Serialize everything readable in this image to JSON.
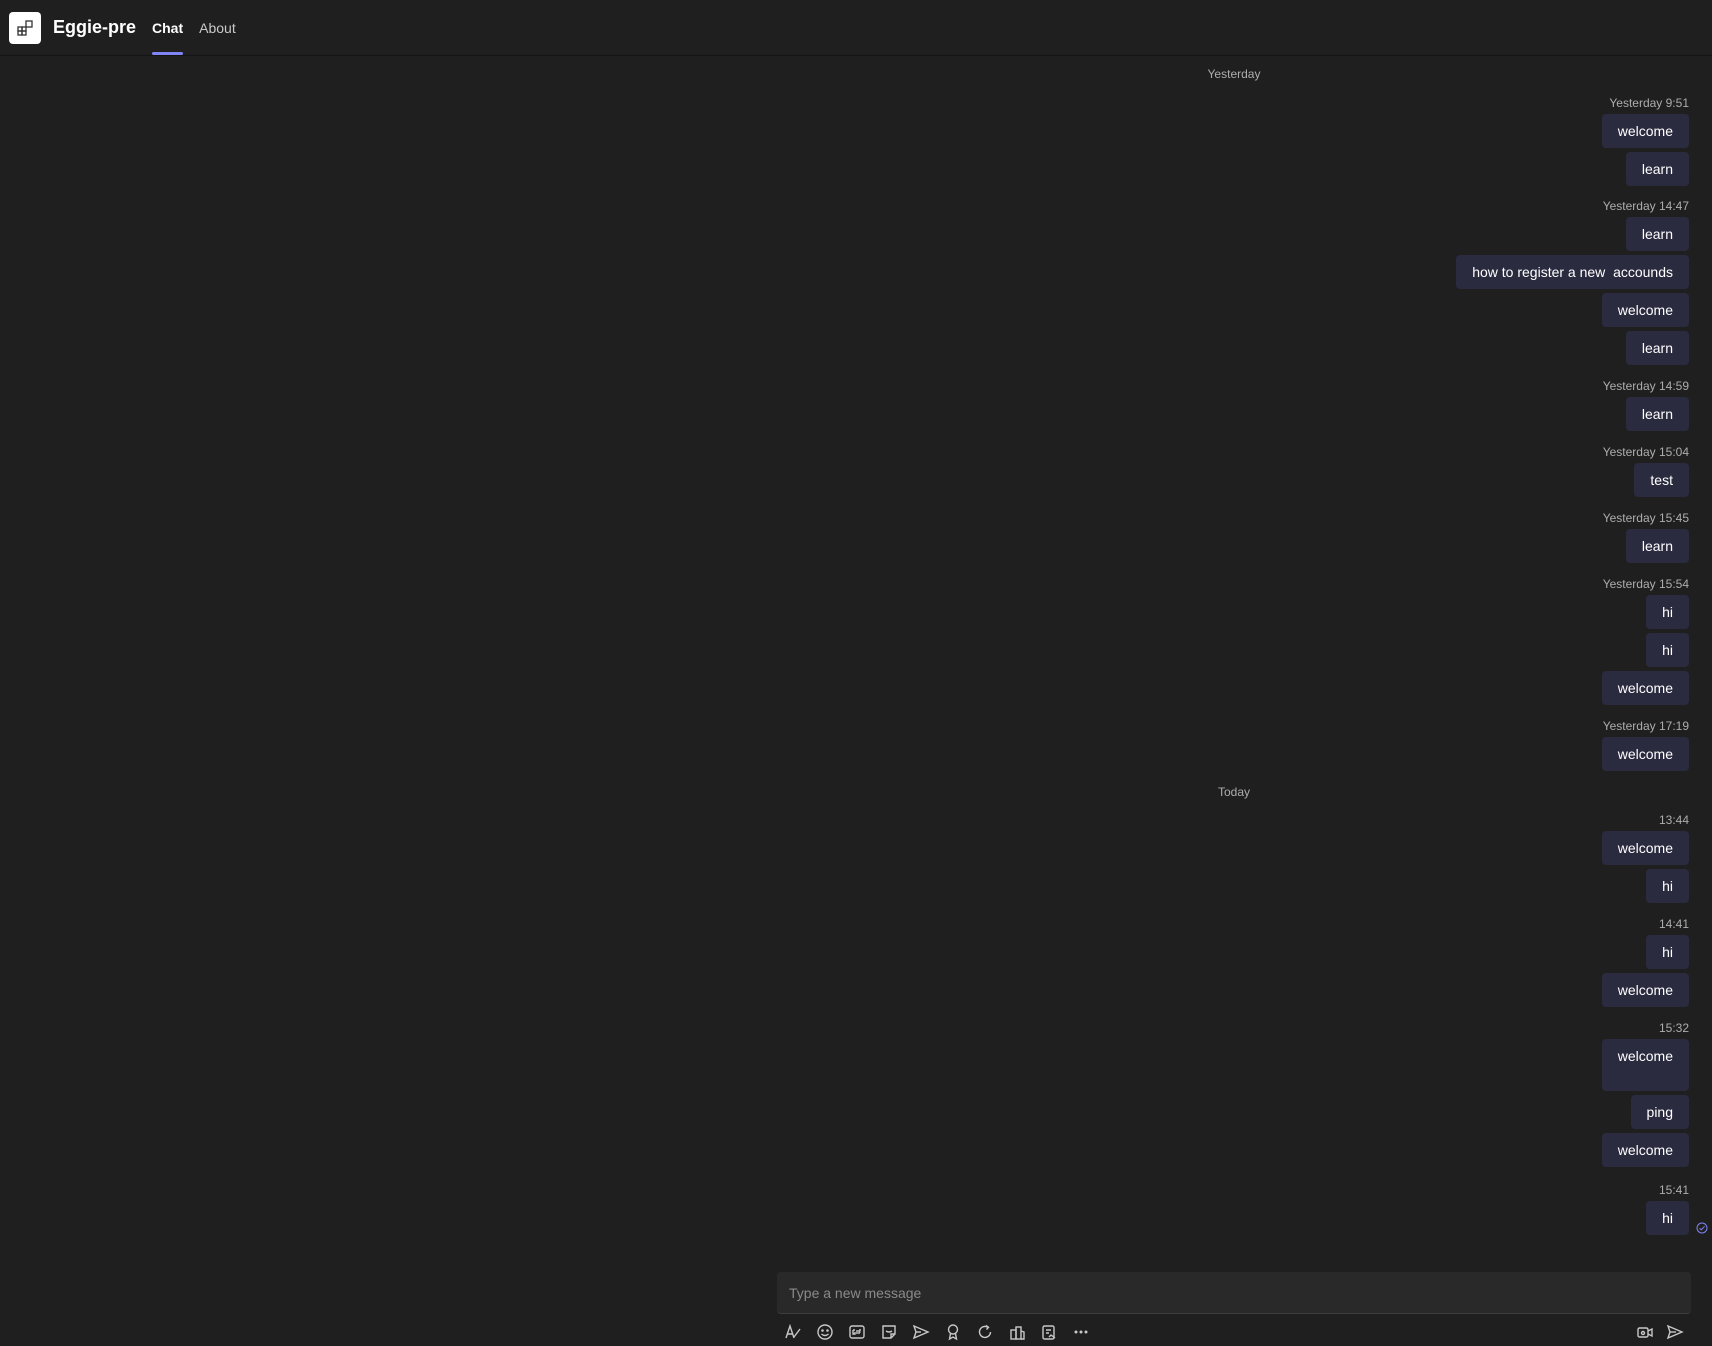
{
  "app": {
    "title": "Eggie-pre"
  },
  "tabs": [
    {
      "label": "Chat"
    },
    {
      "label": "About"
    }
  ],
  "chat": {
    "days": [
      {
        "label": "Yesterday"
      },
      {
        "label": "Today"
      }
    ],
    "groups": [
      {
        "time": "Yesterday 9:51",
        "messages": [
          "welcome",
          "learn"
        ]
      },
      {
        "time": "Yesterday 14:47",
        "messages": [
          "learn",
          "how to register a new  accounds",
          "welcome",
          "learn"
        ]
      },
      {
        "time": "Yesterday 14:59",
        "messages": [
          "learn"
        ]
      },
      {
        "time": "Yesterday 15:04",
        "messages": [
          "test"
        ]
      },
      {
        "time": "Yesterday 15:45",
        "messages": [
          "learn"
        ]
      },
      {
        "time": "Yesterday 15:54",
        "messages": [
          "hi",
          "hi",
          "welcome"
        ]
      },
      {
        "time": "Yesterday 17:19",
        "messages": [
          "welcome"
        ]
      },
      {
        "time": "13:44",
        "messages": [
          "welcome",
          "hi"
        ]
      },
      {
        "time": "14:41",
        "messages": [
          "hi",
          "welcome"
        ]
      },
      {
        "time": "15:32",
        "messages": [
          "welcome",
          "ping",
          "welcome"
        ]
      },
      {
        "time": "15:41",
        "messages": [
          "hi"
        ]
      }
    ]
  },
  "composer": {
    "placeholder": "Type a new message"
  },
  "toolbar": {
    "icons": [
      "format-icon",
      "emoji-icon",
      "gif-icon",
      "sticker-icon",
      "schedule-send-icon",
      "praise-icon",
      "loop-icon",
      "apps-icon",
      "approvals-icon",
      "more-options-icon",
      "audio-message-icon",
      "send-icon"
    ]
  },
  "colors": {
    "accent": "#7f85f5",
    "bubble": "#2b2b40",
    "background": "#1f1f1f"
  }
}
